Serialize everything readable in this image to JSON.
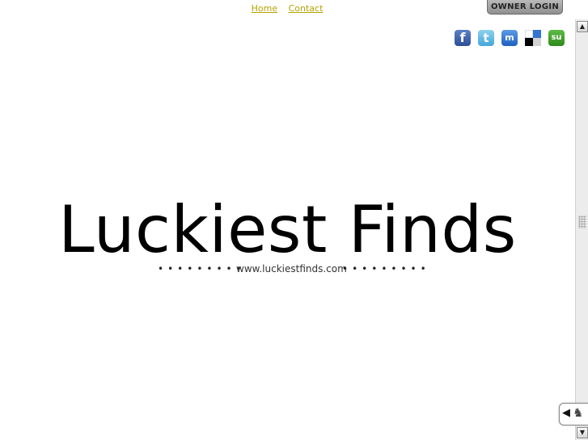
{
  "nav": {
    "home": "Home",
    "contact": "Contact",
    "owner_login": "OWNER LOGIN"
  },
  "social": [
    {
      "name": "facebook",
      "icon": "facebook-icon",
      "glyph": "f",
      "color": "#3b5998"
    },
    {
      "name": "twitter",
      "icon": "twitter-icon",
      "glyph": "t",
      "color": "#55acee"
    },
    {
      "name": "myspace",
      "icon": "myspace-icon",
      "glyph": "m",
      "color": "#2d6ccf"
    },
    {
      "name": "delicious",
      "icon": "delicious-icon",
      "glyph": "",
      "color": "#3274d0"
    },
    {
      "name": "stumbleupon",
      "icon": "stumbleupon-icon",
      "glyph": "su",
      "color": "#3f9d2a"
    }
  ],
  "main": {
    "title": "Luckiest Finds",
    "url": "www.luckiestfinds.com",
    "dots_left": "•••••••••",
    "dots_right": "•••••••••"
  },
  "colors": {
    "nav_link": "#b5a300",
    "title": "#000000",
    "background": "#ffffff"
  },
  "widget": {
    "arrow_glyph": "◀",
    "figure_glyph": "♞"
  }
}
